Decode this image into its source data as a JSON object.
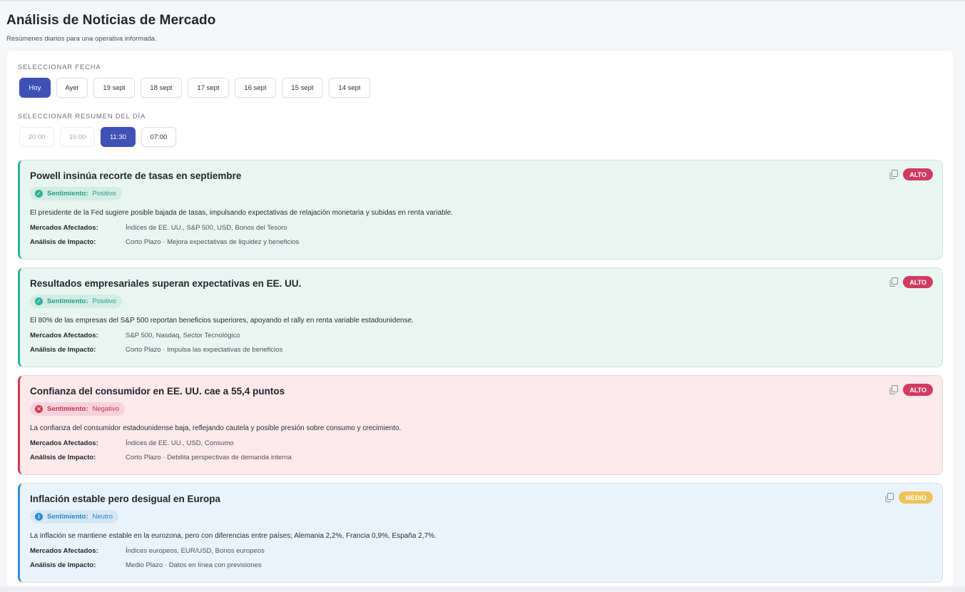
{
  "header": {
    "title": "Análisis de Noticias de Mercado",
    "subtitle": "Resúmenes diarios para una operativa informada."
  },
  "date_section": {
    "label": "SELECCIONAR FECHA",
    "dates": [
      {
        "label": "Hoy",
        "active": true
      },
      {
        "label": "Ayer",
        "active": false
      },
      {
        "label": "19 sept",
        "active": false
      },
      {
        "label": "18 sept",
        "active": false
      },
      {
        "label": "17 sept",
        "active": false
      },
      {
        "label": "16 sept",
        "active": false
      },
      {
        "label": "15 sept",
        "active": false
      },
      {
        "label": "14 sept",
        "active": false
      }
    ]
  },
  "summary_section": {
    "label": "SELECCIONAR RESUMEN DEL DÍA",
    "times": [
      {
        "label": "20:00",
        "state": "disabled"
      },
      {
        "label": "15:00",
        "state": "disabled"
      },
      {
        "label": "11:30",
        "state": "active"
      },
      {
        "label": "07:00",
        "state": "normal"
      }
    ]
  },
  "labels": {
    "sentiment": "Sentimiento:",
    "markets": "Mercados Afectados:",
    "impact": "Análisis de Impacto:"
  },
  "news": [
    {
      "title": "Powell insinúa recorte de tasas en septiembre",
      "sentiment": "Positivo",
      "sentiment_icon": "check-circle-icon",
      "description": "El presidente de la Fed sugiere posible bajada de tasas, impulsando expectativas de relajación monetaria y subidas en renta variable.",
      "markets": "Índices de EE. UU., S&P 500, USD, Bonos del Tesoro",
      "impact": "Corto Plazo · Mejora expectativas de liquidez y beneficios",
      "priority": "ALTO"
    },
    {
      "title": "Resultados empresariales superan expectativas en EE. UU.",
      "sentiment": "Positivo",
      "sentiment_icon": "check-circle-icon",
      "description": "El 80% de las empresas del S&P 500 reportan beneficios superiores, apoyando el rally en renta variable estadounidense.",
      "markets": "S&P 500, Nasdaq, Sector Tecnológico",
      "impact": "Corto Plazo · Impulsa las expectativas de beneficios",
      "priority": "ALTO"
    },
    {
      "title": "Confianza del consumidor en EE. UU. cae a 55,4 puntos",
      "sentiment": "Negativo",
      "sentiment_icon": "x-circle-icon",
      "description": "La confianza del consumidor estadounidense baja, reflejando cautela y posible presión sobre consumo y crecimiento.",
      "markets": "Índices de EE. UU., USD, Consumo",
      "impact": "Corto Plazo · Debilita perspectivas de demanda interna",
      "priority": "ALTO"
    },
    {
      "title": "Inflación estable pero desigual en Europa",
      "sentiment": "Neutro",
      "sentiment_icon": "info-circle-icon",
      "description": "La inflación se mantiene estable en la eurozona, pero con diferencias entre países; Alemania 2,2%, Francia 0,9%, España 2,7%.",
      "markets": "Índices europeos, EUR/USD, Bonos europeos",
      "impact": "Medio Plazo · Datos en línea con previsiones",
      "priority": "MEDIO"
    }
  ],
  "colors": {
    "accent": "#3f51b5",
    "positive": "#2bb39a",
    "negative": "#d03b56",
    "neutral": "#2f8fd0",
    "alto": "#d03b62",
    "medio": "#f0c35a"
  }
}
